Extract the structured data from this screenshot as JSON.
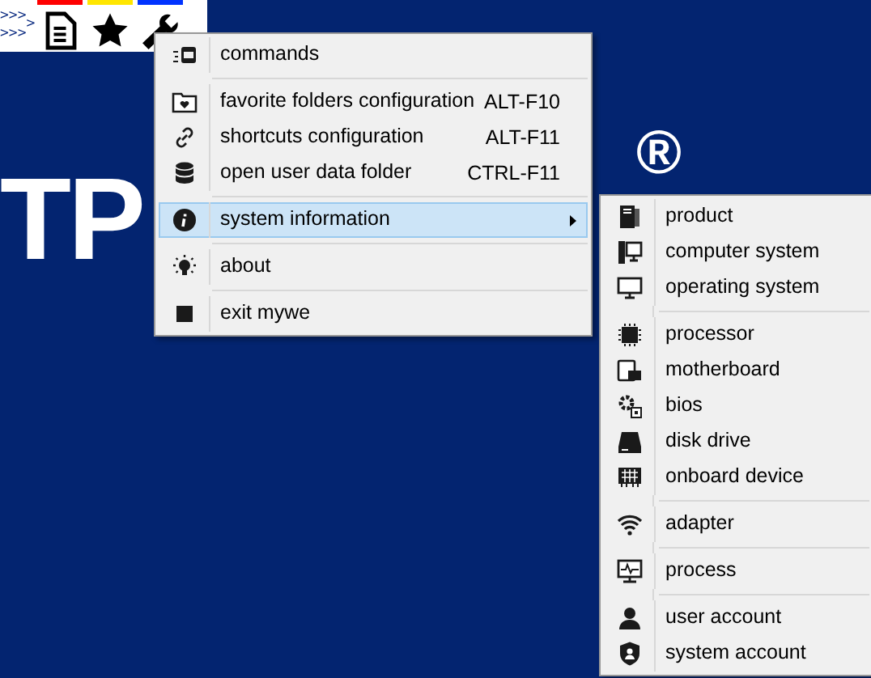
{
  "toolbar": {
    "arrows_top": ">>>",
    "arrows_bottom": ">>>",
    "arrow_mid": ">",
    "buttons": [
      {
        "color": "#ff0000"
      },
      {
        "color": "#ffe600"
      },
      {
        "color": "#0033ff"
      }
    ]
  },
  "background": {
    "logo_text": "TP",
    "registered_mark": "®"
  },
  "menu": {
    "groups": [
      [
        {
          "label": "commands",
          "selected": false
        }
      ],
      [
        {
          "label": "favorite folders configuration",
          "shortcut": "ALT-F10",
          "selected": false
        },
        {
          "label": "shortcuts configuration",
          "shortcut": "ALT-F11",
          "selected": false
        },
        {
          "label": "open user data folder",
          "shortcut": "CTRL-F11",
          "selected": false
        }
      ],
      [
        {
          "label": "system information",
          "selected": true,
          "submenu": true
        }
      ],
      [
        {
          "label": "about",
          "selected": false
        }
      ],
      [
        {
          "label": "exit mywe",
          "selected": false
        }
      ]
    ]
  },
  "submenu": {
    "groups": [
      [
        {
          "label": "product",
          "selected": false
        },
        {
          "label": "computer system",
          "selected": false
        },
        {
          "label": "operating system",
          "selected": false
        }
      ],
      [
        {
          "label": "processor",
          "selected": false
        },
        {
          "label": "motherboard",
          "selected": false
        },
        {
          "label": "bios",
          "selected": false
        },
        {
          "label": "disk drive",
          "selected": false
        },
        {
          "label": "onboard device",
          "selected": false
        }
      ],
      [
        {
          "label": "adapter",
          "selected": false
        }
      ],
      [
        {
          "label": "process",
          "selected": false
        }
      ],
      [
        {
          "label": "user account",
          "selected": false
        },
        {
          "label": "system account",
          "selected": false
        }
      ]
    ]
  }
}
